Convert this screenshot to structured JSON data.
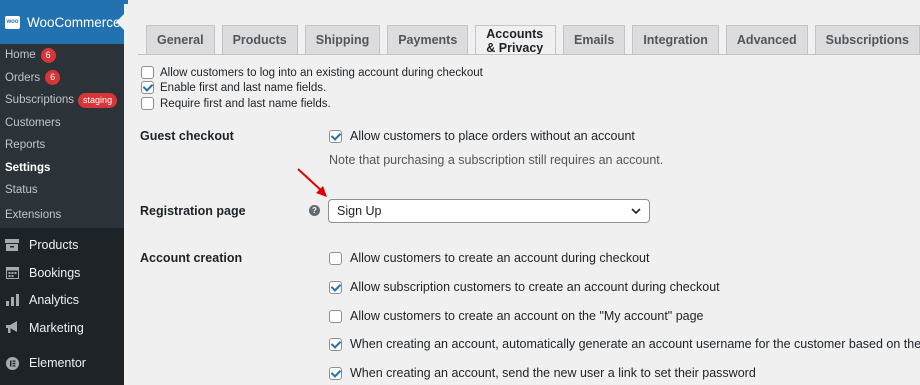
{
  "sidebar": {
    "brand": "WooCommerce",
    "brand_logo_text": "woo",
    "sub_items": [
      {
        "label": "Home",
        "badge": "6"
      },
      {
        "label": "Orders",
        "badge": "6"
      },
      {
        "label": "Subscriptions",
        "badge": "staging"
      },
      {
        "label": "Customers"
      },
      {
        "label": "Reports"
      },
      {
        "label": "Settings",
        "active": true
      },
      {
        "label": "Status"
      },
      {
        "label": "Extensions"
      }
    ],
    "main_items": [
      {
        "label": "Products",
        "icon": "archive-icon"
      },
      {
        "label": "Bookings",
        "icon": "calendar-icon"
      },
      {
        "label": "Analytics",
        "icon": "bar-chart-icon"
      },
      {
        "label": "Marketing",
        "icon": "megaphone-icon"
      },
      {
        "label": "Elementor",
        "icon": "elementor-icon"
      }
    ]
  },
  "tabs": [
    "General",
    "Products",
    "Shipping",
    "Payments",
    "Accounts & Privacy",
    "Emails",
    "Integration",
    "Advanced",
    "Subscriptions"
  ],
  "active_tab": "Accounts & Privacy",
  "top_options": [
    {
      "label": "Allow customers to log into an existing account during checkout",
      "checked": false
    },
    {
      "label": "Enable first and last name fields.",
      "checked": true
    },
    {
      "label": "Require first and last name fields.",
      "checked": false
    }
  ],
  "guest_checkout": {
    "label": "Guest checkout",
    "option": "Allow customers to place orders without an account",
    "checked": true,
    "note": "Note that purchasing a subscription still requires an account."
  },
  "registration_page": {
    "label": "Registration page",
    "help": "?",
    "selected": "Sign Up"
  },
  "account_creation": {
    "label": "Account creation",
    "options": [
      {
        "label": "Allow customers to create an account during checkout",
        "checked": false
      },
      {
        "label": "Allow subscription customers to create an account during checkout",
        "checked": true
      },
      {
        "label": "Allow customers to create an account on the \"My account\" page",
        "checked": false
      },
      {
        "label": "When creating an account, automatically generate an account username for the customer based on their name",
        "checked": true
      },
      {
        "label": "When creating an account, send the new user a link to set their password",
        "checked": true
      }
    ]
  },
  "colors": {
    "accent": "#2271b1",
    "sidebar_bg": "#1d2327",
    "badge": "#d63638",
    "annotation_arrow": "#e00000"
  }
}
